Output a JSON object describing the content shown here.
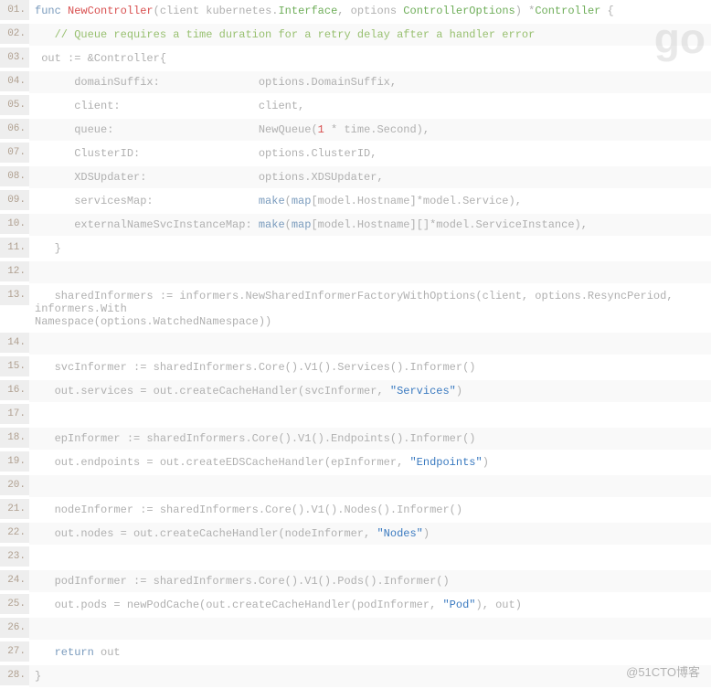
{
  "watermarks": {
    "top_right": "go",
    "bottom_right": "@51CTO博客"
  },
  "lines": [
    {
      "n": "01.",
      "alt": false,
      "tokens": [
        {
          "c": "kw",
          "t": "func "
        },
        {
          "c": "fn",
          "t": "NewController"
        },
        {
          "c": "op",
          "t": "("
        },
        {
          "c": "plain",
          "t": "client kubernetes."
        },
        {
          "c": "type",
          "t": "Interface"
        },
        {
          "c": "plain",
          "t": ", options "
        },
        {
          "c": "type",
          "t": "ControllerOptions"
        },
        {
          "c": "op",
          "t": ") "
        },
        {
          "c": "op",
          "t": "*"
        },
        {
          "c": "type",
          "t": "Controller"
        },
        {
          "c": "plain",
          "t": " {"
        }
      ]
    },
    {
      "n": "02.",
      "alt": true,
      "tokens": [
        {
          "c": "plain",
          "t": "   "
        },
        {
          "c": "cmt",
          "t": "// Queue requires a time duration for a retry delay after a handler error"
        }
      ]
    },
    {
      "n": "03.",
      "alt": false,
      "tokens": [
        {
          "c": "plain",
          "t": " out := &Controller{"
        }
      ]
    },
    {
      "n": "04.",
      "alt": true,
      "tokens": [
        {
          "c": "plain",
          "t": "      domainSuffix:               options.DomainSuffix,"
        }
      ]
    },
    {
      "n": "05.",
      "alt": false,
      "tokens": [
        {
          "c": "plain",
          "t": "      client:                     client,"
        }
      ]
    },
    {
      "n": "06.",
      "alt": true,
      "tokens": [
        {
          "c": "plain",
          "t": "      queue:                      NewQueue("
        },
        {
          "c": "num",
          "t": "1"
        },
        {
          "c": "plain",
          "t": " * time.Second),"
        }
      ]
    },
    {
      "n": "07.",
      "alt": false,
      "tokens": [
        {
          "c": "plain",
          "t": "      ClusterID:                  options.ClusterID,"
        }
      ]
    },
    {
      "n": "08.",
      "alt": true,
      "tokens": [
        {
          "c": "plain",
          "t": "      XDSUpdater:                 options.XDSUpdater,"
        }
      ]
    },
    {
      "n": "09.",
      "alt": false,
      "tokens": [
        {
          "c": "plain",
          "t": "      servicesMap:                "
        },
        {
          "c": "kw",
          "t": "make"
        },
        {
          "c": "plain",
          "t": "("
        },
        {
          "c": "kw",
          "t": "map"
        },
        {
          "c": "plain",
          "t": "[model.Hostname]*model.Service),"
        }
      ]
    },
    {
      "n": "10.",
      "alt": true,
      "tokens": [
        {
          "c": "plain",
          "t": "      externalNameSvcInstanceMap: "
        },
        {
          "c": "kw",
          "t": "make"
        },
        {
          "c": "plain",
          "t": "("
        },
        {
          "c": "kw",
          "t": "map"
        },
        {
          "c": "plain",
          "t": "[model.Hostname][]*model.ServiceInstance),"
        }
      ]
    },
    {
      "n": "11.",
      "alt": false,
      "tokens": [
        {
          "c": "plain",
          "t": "   }"
        }
      ]
    },
    {
      "n": "12.",
      "alt": true,
      "tokens": [
        {
          "c": "plain",
          "t": " "
        }
      ]
    },
    {
      "n": "13.",
      "alt": false,
      "wrap": true,
      "tokens": [
        {
          "c": "plain",
          "t": "   sharedInformers := informers.NewSharedInformerFactoryWithOptions(client, options.ResyncPeriod, informers.With\nNamespace(options.WatchedNamespace))"
        }
      ]
    },
    {
      "n": "14.",
      "alt": true,
      "tokens": [
        {
          "c": "plain",
          "t": " "
        }
      ]
    },
    {
      "n": "15.",
      "alt": false,
      "tokens": [
        {
          "c": "plain",
          "t": "   svcInformer := sharedInformers.Core().V1().Services().Informer()"
        }
      ]
    },
    {
      "n": "16.",
      "alt": true,
      "tokens": [
        {
          "c": "plain",
          "t": "   out.services = out.createCacheHandler(svcInformer, "
        },
        {
          "c": "str",
          "t": "\"Services\""
        },
        {
          "c": "plain",
          "t": ")"
        }
      ]
    },
    {
      "n": "17.",
      "alt": false,
      "tokens": [
        {
          "c": "plain",
          "t": " "
        }
      ]
    },
    {
      "n": "18.",
      "alt": true,
      "tokens": [
        {
          "c": "plain",
          "t": "   epInformer := sharedInformers.Core().V1().Endpoints().Informer()"
        }
      ]
    },
    {
      "n": "19.",
      "alt": false,
      "tokens": [
        {
          "c": "plain",
          "t": "   out.endpoints = out.createEDSCacheHandler(epInformer, "
        },
        {
          "c": "str",
          "t": "\"Endpoints\""
        },
        {
          "c": "plain",
          "t": ")"
        }
      ]
    },
    {
      "n": "20.",
      "alt": true,
      "tokens": [
        {
          "c": "plain",
          "t": " "
        }
      ]
    },
    {
      "n": "21.",
      "alt": false,
      "tokens": [
        {
          "c": "plain",
          "t": "   nodeInformer := sharedInformers.Core().V1().Nodes().Informer()"
        }
      ]
    },
    {
      "n": "22.",
      "alt": true,
      "tokens": [
        {
          "c": "plain",
          "t": "   out.nodes = out.createCacheHandler(nodeInformer, "
        },
        {
          "c": "str",
          "t": "\"Nodes\""
        },
        {
          "c": "plain",
          "t": ")"
        }
      ]
    },
    {
      "n": "23.",
      "alt": false,
      "tokens": [
        {
          "c": "plain",
          "t": " "
        }
      ]
    },
    {
      "n": "24.",
      "alt": true,
      "tokens": [
        {
          "c": "plain",
          "t": "   podInformer := sharedInformers.Core().V1().Pods().Informer()"
        }
      ]
    },
    {
      "n": "25.",
      "alt": false,
      "tokens": [
        {
          "c": "plain",
          "t": "   out.pods = newPodCache(out.createCacheHandler(podInformer, "
        },
        {
          "c": "str",
          "t": "\"Pod\""
        },
        {
          "c": "plain",
          "t": "), out)"
        }
      ]
    },
    {
      "n": "26.",
      "alt": true,
      "tokens": [
        {
          "c": "plain",
          "t": " "
        }
      ]
    },
    {
      "n": "27.",
      "alt": false,
      "tokens": [
        {
          "c": "plain",
          "t": "   "
        },
        {
          "c": "kw",
          "t": "return"
        },
        {
          "c": "plain",
          "t": " out"
        }
      ]
    },
    {
      "n": "28.",
      "alt": true,
      "tokens": [
        {
          "c": "plain",
          "t": "}"
        }
      ]
    }
  ]
}
